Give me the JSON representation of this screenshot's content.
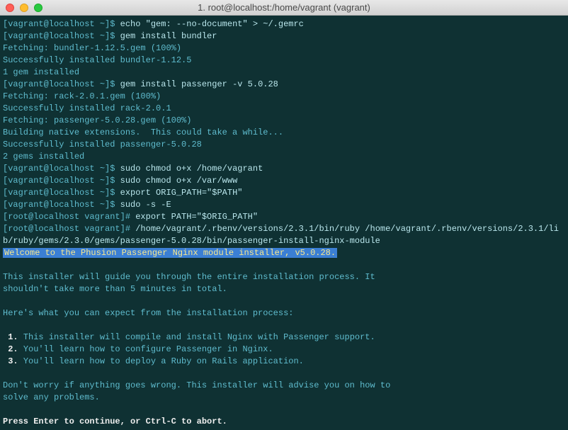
{
  "window": {
    "title": "1. root@localhost:/home/vagrant (vagrant)"
  },
  "lines": {
    "l1_prompt": "[vagrant@localhost ~]$ ",
    "l1_cmd": "echo \"gem: --no-document\" > ~/.gemrc",
    "l2_prompt": "[vagrant@localhost ~]$ ",
    "l2_cmd": "gem install bundler",
    "l3": "Fetching: bundler-1.12.5.gem (100%)",
    "l4": "Successfully installed bundler-1.12.5",
    "l5": "1 gem installed",
    "l6_prompt": "[vagrant@localhost ~]$ ",
    "l6_cmd": "gem install passenger -v 5.0.28",
    "l7": "Fetching: rack-2.0.1.gem (100%)",
    "l8": "Successfully installed rack-2.0.1",
    "l9": "Fetching: passenger-5.0.28.gem (100%)",
    "l10": "Building native extensions.  This could take a while...",
    "l11": "Successfully installed passenger-5.0.28",
    "l12": "2 gems installed",
    "l13_prompt": "[vagrant@localhost ~]$ ",
    "l13_cmd": "sudo chmod o+x /home/vagrant",
    "l14_prompt": "[vagrant@localhost ~]$ ",
    "l14_cmd": "sudo chmod o+x /var/www",
    "l15_prompt": "[vagrant@localhost ~]$ ",
    "l15_cmd": "export ORIG_PATH=\"$PATH\"",
    "l16_prompt": "[vagrant@localhost ~]$ ",
    "l16_cmd": "sudo -s -E",
    "l17_prompt": "[root@localhost vagrant]# ",
    "l17_cmd": "export PATH=\"$ORIG_PATH\"",
    "l18_prompt": "[root@localhost vagrant]# ",
    "l18_cmd": "/home/vagrant/.rbenv/versions/2.3.1/bin/ruby /home/vagrant/.rbenv/versions/2.3.1/lib/ruby/gems/2.3.0/gems/passenger-5.0.28/bin/passenger-install-nginx-module",
    "welcome": "Welcome to the Phusion Passenger Nginx module installer, v5.0.28.",
    "intro1": "This installer will guide you through the entire installation process. It",
    "intro2": "shouldn't take more than 5 minutes in total.",
    "expect": "Here's what you can expect from the installation process:",
    "step1_num": " 1. ",
    "step1_text": "This installer will compile and install Nginx with Passenger support.",
    "step2_num": " 2. ",
    "step2_text": "You'll learn how to configure Passenger in Nginx.",
    "step3_num": " 3. ",
    "step3_text": "You'll learn how to deploy a Ruby on Rails application.",
    "worry1": "Don't worry if anything goes wrong. This installer will advise you on how to",
    "worry2": "solve any problems.",
    "final": "Press Enter to continue, or Ctrl-C to abort."
  }
}
